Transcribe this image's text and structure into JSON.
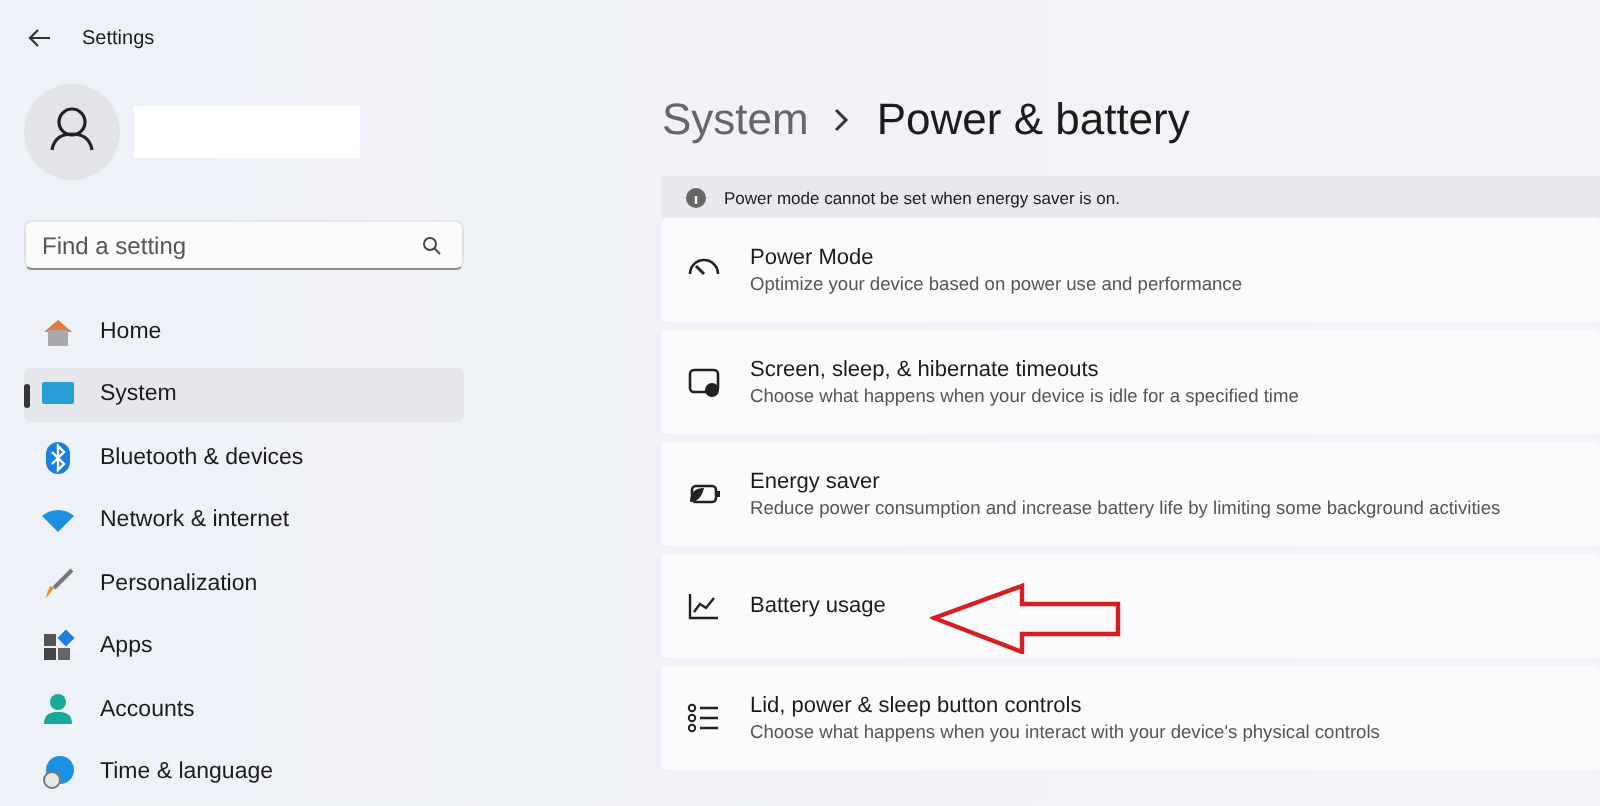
{
  "window": {
    "title": "Settings"
  },
  "search": {
    "placeholder": "Find a setting"
  },
  "sidebar": {
    "items": [
      {
        "label": "Home",
        "kind": "home",
        "selected": false
      },
      {
        "label": "System",
        "kind": "system",
        "selected": true
      },
      {
        "label": "Bluetooth & devices",
        "kind": "bluetooth",
        "selected": false
      },
      {
        "label": "Network & internet",
        "kind": "network",
        "selected": false
      },
      {
        "label": "Personalization",
        "kind": "brush",
        "selected": false
      },
      {
        "label": "Apps",
        "kind": "apps",
        "selected": false
      },
      {
        "label": "Accounts",
        "kind": "accounts",
        "selected": false
      },
      {
        "label": "Time & language",
        "kind": "time",
        "selected": false
      }
    ]
  },
  "breadcrumb": [
    "System",
    "Power & battery"
  ],
  "info_bar": "Power mode cannot be set when energy saver is on.",
  "cards": [
    {
      "title": "Power Mode",
      "subtitle": "Optimize your device based on power use and performance",
      "kind": "gauge"
    },
    {
      "title": "Screen, sleep, & hibernate timeouts",
      "subtitle": "Choose what happens when your device is idle for a specified time",
      "kind": "screen"
    },
    {
      "title": "Energy saver",
      "subtitle": "Reduce power consumption and increase battery life by limiting some background activities",
      "kind": "battery"
    },
    {
      "title": "Battery usage",
      "kind": "chart"
    },
    {
      "title": "Lid, power & sleep button controls",
      "subtitle": "Choose what happens when you interact with your device's physical controls",
      "kind": "list"
    }
  ]
}
